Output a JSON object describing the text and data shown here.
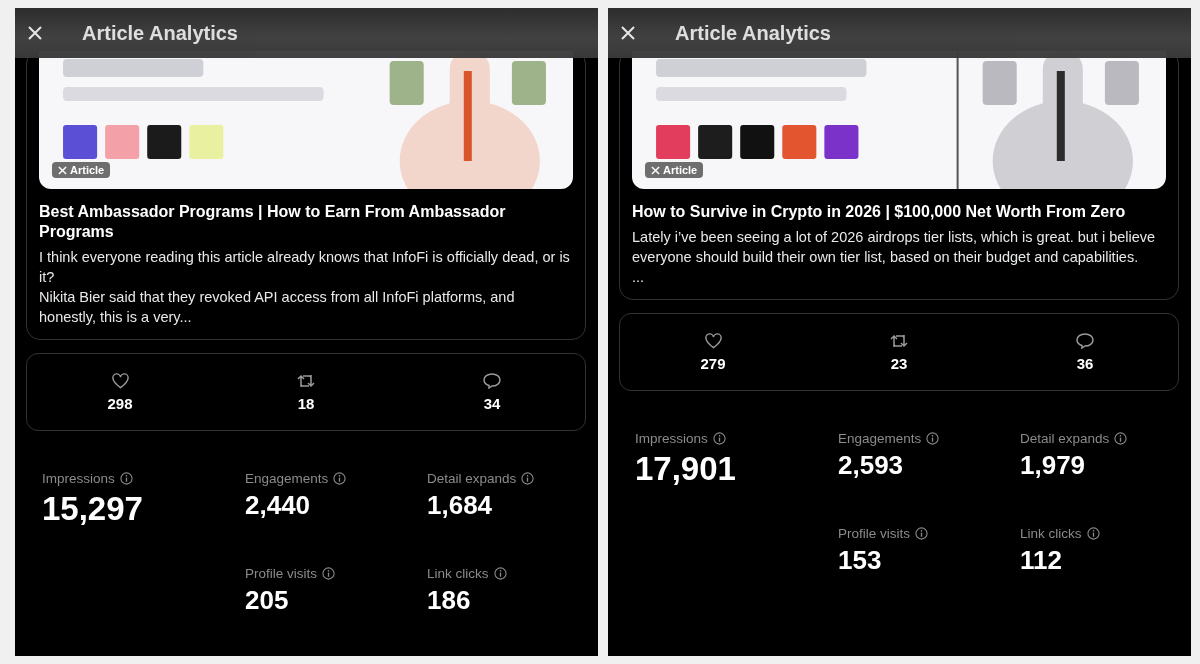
{
  "panels": [
    {
      "header": {
        "title": "Article Analytics"
      },
      "article": {
        "cover": {
          "kind": "picture"
        },
        "badge": "Article",
        "title": "Best Ambassador Programs | How to Earn From Ambassador Programs",
        "excerpt": [
          "I think everyone reading this article already knows that InfoFi is officially dead, or is it?",
          "Nikita Bier said that they revoked API access from all InfoFi platforms, and honestly, this is a very..."
        ]
      },
      "engagement": [
        {
          "kind": "likes",
          "count": "298"
        },
        {
          "kind": "reposts",
          "count": "18"
        },
        {
          "kind": "replies",
          "count": "34"
        }
      ],
      "metrics": [
        {
          "kind": "primary",
          "label": "Impressions",
          "value": "15,297"
        },
        {
          "kind": "secondary",
          "label": "Engagements",
          "value": "2,440"
        },
        {
          "kind": "secondary",
          "label": "Detail expands",
          "value": "1,684"
        },
        {
          "kind": "secondary",
          "label": "Profile visits",
          "value": "205"
        },
        {
          "kind": "secondary",
          "label": "Link clicks",
          "value": "186"
        }
      ]
    },
    {
      "header": {
        "title": "Article Analytics"
      },
      "article": {
        "cover": {
          "kind": "picture"
        },
        "badge": "Article",
        "title": "How to Survive in Crypto in 2026 | $100,000 Net Worth From Zero",
        "excerpt": [
          "Lately i’ve been seeing a lot of 2026 airdrops tier lists, which is great. but i believe everyone should build their own tier list, based on their budget and capabilities.",
          "..."
        ]
      },
      "engagement": [
        {
          "kind": "likes",
          "count": "279"
        },
        {
          "kind": "reposts",
          "count": "23"
        },
        {
          "kind": "replies",
          "count": "36"
        }
      ],
      "metrics": [
        {
          "kind": "primary",
          "label": "Impressions",
          "value": "17,901"
        },
        {
          "kind": "secondary",
          "label": "Engagements",
          "value": "2,593"
        },
        {
          "kind": "secondary",
          "label": "Detail expands",
          "value": "1,979"
        },
        {
          "kind": "secondary",
          "label": "Profile visits",
          "value": "153"
        },
        {
          "kind": "secondary",
          "label": "Link clicks",
          "value": "112"
        }
      ]
    }
  ]
}
